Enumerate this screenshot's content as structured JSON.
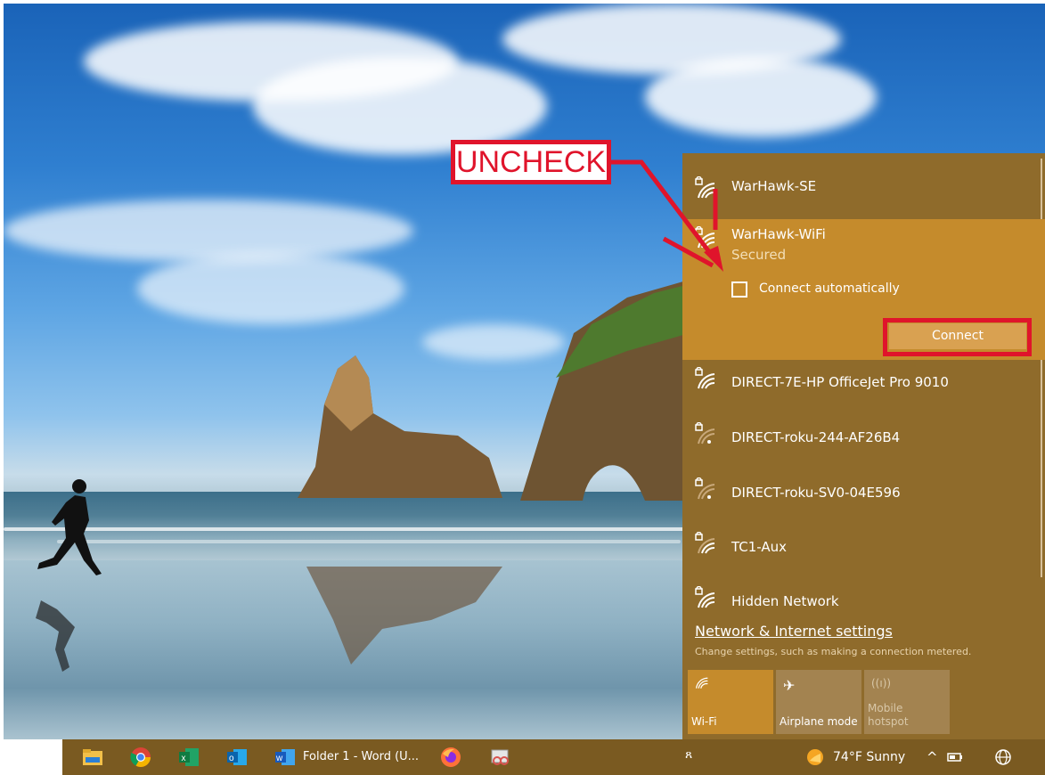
{
  "annotation": {
    "callout_label": "UNCHECK"
  },
  "wifi": {
    "networks": [
      {
        "ssid": "WarHawk-SE",
        "secured": true,
        "signal": "full"
      },
      {
        "ssid": "WarHawk-WiFi",
        "secured": true,
        "signal": "full",
        "expanded": true,
        "status": "Secured",
        "connect_automatically": false
      },
      {
        "ssid": "DIRECT-7E-HP OfficeJet Pro 9010",
        "secured": true,
        "signal": "full"
      },
      {
        "ssid": "DIRECT-roku-244-AF26B4",
        "secured": true,
        "signal": "weak"
      },
      {
        "ssid": "DIRECT-roku-SV0-04E596",
        "secured": true,
        "signal": "weak"
      },
      {
        "ssid": "TC1-Aux",
        "secured": true,
        "signal": "medium"
      },
      {
        "ssid": "Hidden Network",
        "secured": true,
        "signal": "full"
      }
    ],
    "connect_automatically_label": "Connect automatically",
    "connect_button_label": "Connect",
    "settings_link": "Network & Internet settings",
    "settings_desc": "Change settings, such as making a connection metered.",
    "quick_actions": [
      {
        "label": "Wi-Fi",
        "icon": "wifi-icon",
        "active": true
      },
      {
        "label": "Airplane mode",
        "icon": "airplane-icon",
        "active": false
      },
      {
        "label": "Mobile hotspot",
        "icon": "hotspot-icon",
        "active": false,
        "disabled": true
      }
    ]
  },
  "taskbar": {
    "apps": [
      "file-explorer-icon",
      "chrome-icon",
      "excel-icon",
      "outlook-icon",
      "word-icon",
      "firefox-icon",
      "snipping-tool-icon"
    ],
    "word_window_label": "Folder 1 - Word (U...",
    "weather": "74°F  Sunny",
    "tray_up_arrow": "^",
    "colors": {
      "taskbar": "#7a5a21",
      "flyout": "#8f6b2b",
      "accent": "#c58b2c",
      "annotation": "#e0142b"
    }
  }
}
